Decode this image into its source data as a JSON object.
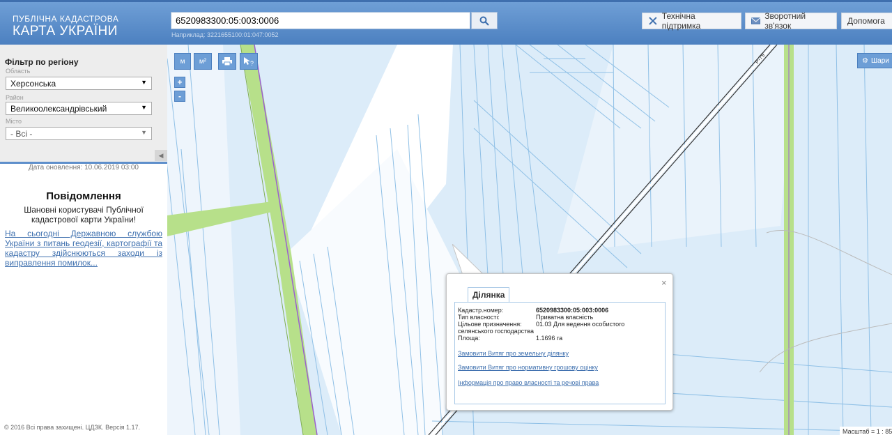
{
  "header": {
    "logo_line1": "ПУБЛІЧНА КАДАСТРОВА",
    "logo_line2": "КАРТА УКРАЇНИ",
    "search_value": "6520983300:05:003:0006",
    "search_hint": "Наприклад: 3221655100:01:047:0052",
    "buttons": {
      "support": "Технічна підтримка",
      "feedback": "Зворотний зв'язок",
      "help": "Допомога"
    }
  },
  "sidebar": {
    "filter_title": "Фільтр по регіону",
    "oblast_label": "Область",
    "oblast_value": "Херсонська",
    "raion_label": "Район",
    "raion_value": "Великоолександрівський",
    "misto_label": "Місто",
    "misto_value": "- Всі -",
    "update_date": "Дата оновлення: 10.06.2019 03:00",
    "message_title": "Повідомлення",
    "message_greeting": "Шановні користувачі Публічної кадастрової карти України!",
    "message_link": "На сьогодні Державною службою України з питань геодезії, картографії та кадастру здійснюються заходи із виправлення помилок...",
    "copyright": "© 2016 Всі права захищені. ЦДЗК. Версія 1.17."
  },
  "map": {
    "tools": [
      "м",
      "м²"
    ],
    "zoom_in": "+",
    "zoom_out": "-",
    "layers_label": "Шари",
    "road_label": "Р-79",
    "scale_text": "Масштаб = 1 : 85"
  },
  "popup": {
    "tab_label": "Ділянка",
    "close": "×",
    "fields": {
      "cadastr_label": "Кадастр.номер:",
      "cadastr_value": "6520983300:05:003:0006",
      "ownership_label": "Тип власності:",
      "ownership_value": "Приватна власність",
      "purpose_label": "Цільове призначення:",
      "purpose_value": "01.03 Для ведення особистого",
      "purpose_value2": "селянського господарства",
      "area_label": "Площа:",
      "area_value": "1.1696 га"
    },
    "links": [
      "Замовити Витяг про земельну ділянку",
      "Замовити Витяг про нормативну грошову оцінку",
      "Інформація про право власності та речові права"
    ]
  },
  "colors": {
    "header": "#5b8ccb",
    "parcel_fill": "#dcecf9",
    "parcel_stroke": "#7ab3e0",
    "green_strip": "#b7e08a",
    "link": "#3d6fae"
  }
}
